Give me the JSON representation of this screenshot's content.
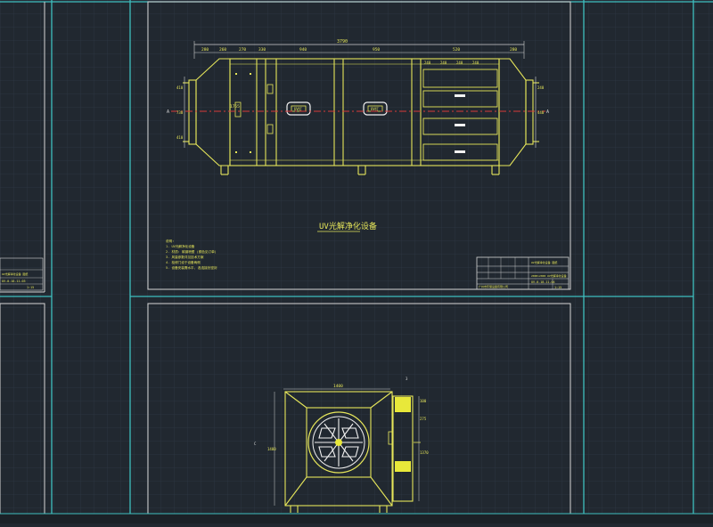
{
  "drawing": {
    "title_label": "UV光解净化设备",
    "colors": {
      "background": "#212830",
      "grid": "#2c3540",
      "frame": "#3fbfbf",
      "sheet": "#d6d6d6",
      "part": "#e6e65a",
      "centerline": "#d63a3a",
      "dim": "#cfcfcf",
      "fill_yellow": "#e8e83a"
    }
  },
  "top_view": {
    "overall_dim": "3790",
    "dims_top": [
      "280",
      "260",
      "270",
      "330",
      "940",
      "950",
      "520",
      "280"
    ],
    "dims_left": [
      "410",
      "730",
      "410"
    ],
    "dims_right": [
      "240",
      "440"
    ],
    "label_a_left": "A",
    "label_a_right": "A",
    "lamp_a": "UV灯",
    "lamp_b": "UV灯",
    "filter_label": "1755",
    "notes": [
      "说明:",
      "1. UV光解净化设备",
      "2. 材质: 碳钢喷塑 (颜色见订单)",
      "3. 风量参数详见技术方案",
      "4. 检修门设于设备两侧",
      "5. 设备安装需水平, 各连接处密封"
    ]
  },
  "title_block_right": {
    "company": "广州市环保设备有限公司",
    "project": "UV光解净化设备 图纸",
    "code": "UV-0-18-11-04",
    "scale": "1:15",
    "ratio_line": "2000×2000 UV光解净化设备"
  },
  "title_block_left": {
    "line1": "UV光解净化设备 图纸",
    "code": "UV-0-18-11-03",
    "scale": "1:15"
  },
  "side_view": {
    "width_dim": "1400",
    "height_dim": "1400",
    "right_dims": [
      "100",
      "275",
      "1370"
    ],
    "top_dim": "3",
    "label_left": "C"
  }
}
